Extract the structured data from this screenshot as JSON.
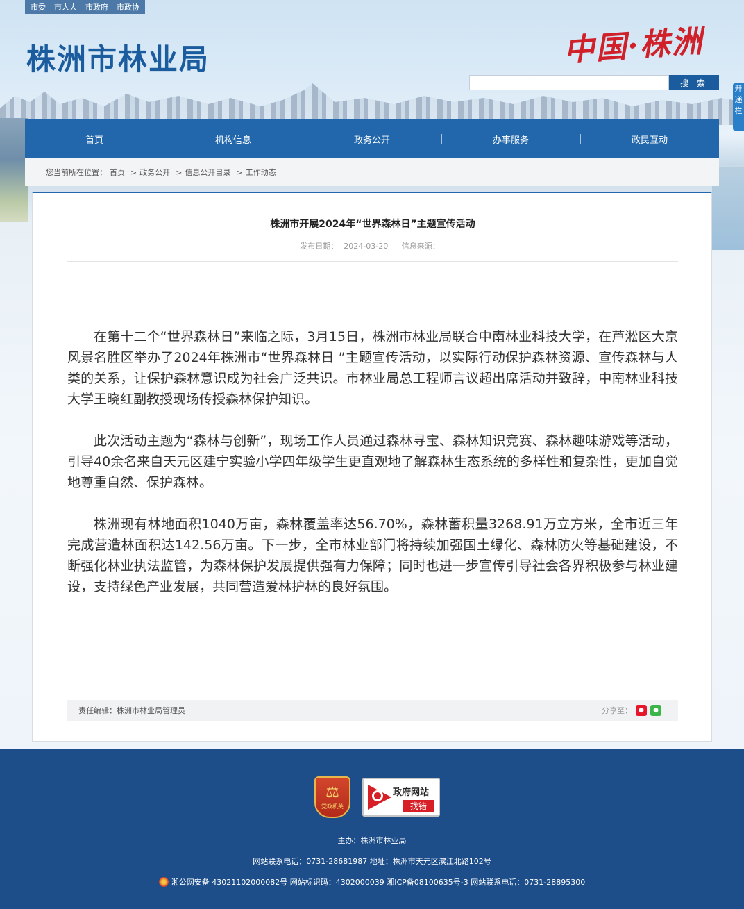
{
  "top_links": [
    "市委",
    "市人大",
    "市政府",
    "市政协"
  ],
  "site": {
    "title": "株洲市林业局",
    "brand": "中国·株洲"
  },
  "search": {
    "placeholder": "",
    "button_label": "搜 索"
  },
  "side_float": "开递栏",
  "nav": [
    "首页",
    "机构信息",
    "政务公开",
    "办事服务",
    "政民互动"
  ],
  "breadcrumb": {
    "label": "您当前所在位置：",
    "items": [
      "首页",
      "政务公开",
      "信息公开目录",
      "工作动态"
    ]
  },
  "article": {
    "title": "株洲市开展2024年“世界森林日”主题宣传活动",
    "date_label": "发布日期：",
    "date": "2024-03-20",
    "source_label": "信息来源：",
    "source": "",
    "paragraphs": [
      "在第十二个“世界森林日”来临之际，3月15日，株洲市林业局联合中南林业科技大学，在芦淞区大京风景名胜区举办了2024年株洲市“世界森林日 ”主题宣传活动，以实际行动保护森林资源、宣传森林与人类的关系，让保护森林意识成为社会广泛共识。市林业局总工程师言议超出席活动并致辞，中南林业科技大学王晓红副教授现场传授森林保护知识。",
      "此次活动主题为“森林与创新”，现场工作人员通过森林寻宝、森林知识竞赛、森林趣味游戏等活动，引导40余名来自天元区建宁实验小学四年级学生更直观地了解森林生态系统的多样性和复杂性，更加自觉地尊重自然、保护森林。",
      "株洲现有林地面积1040万亩，森林覆盖率达56.70%，森林蓄积量3268.91万立方米，全市近三年完成营造林面积达142.56万亩。下一步，全市林业部门将持续加强国土绿化、森林防火等基础建设，不断强化林业执法监管，为森林保护发展提供强有力保障；同时也进一步宣传引导社会各界积极参与林业建设，支持绿色产业发展，共同营造爱林护林的良好氛围。"
    ],
    "editor_label": "责任编辑：",
    "editor": "株洲市林业局管理员",
    "share_label": "分享至："
  },
  "footer": {
    "badge_text": "党政机关",
    "error_title": "政府网站",
    "error_sub": "找错",
    "host": "主办：株洲市林业局",
    "contact": "网站联系电话：0731-28681987 地址：株洲市天元区滨江北路102号",
    "record": "湘公网安备 43021102000082号 网站标识码：4302000039 湘ICP备08100635号-3 网站联系电话：0731-28895300"
  },
  "colors": {
    "brand_blue": "#2267ab",
    "footer_blue": "#1d4e8a",
    "brand_red": "#d0202a"
  }
}
